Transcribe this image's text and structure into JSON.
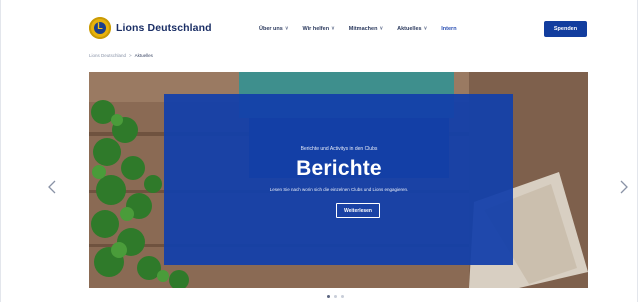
{
  "header": {
    "logo_glyph": "L",
    "logo_text": "Lions Deutschland",
    "nav": [
      {
        "label": "Über uns",
        "has_dropdown": true
      },
      {
        "label": "Wir helfen",
        "has_dropdown": true
      },
      {
        "label": "Mitmachen",
        "has_dropdown": true
      },
      {
        "label": "Aktuelles",
        "has_dropdown": true
      },
      {
        "label": "Intern",
        "has_dropdown": false
      }
    ],
    "donate_label": "Spenden",
    "accent_color": "#123d9e"
  },
  "breadcrumb": {
    "home": "Lions Deutschland",
    "separator": ">",
    "current": "Aktuelles"
  },
  "hero": {
    "kicker": "Berichte und Activitys in den Clubs",
    "title": "Berichte",
    "description": "Lesen Sie nach worin sich die einzelnen Clubs und Lions engagieren.",
    "button_label": "Weiterlesen",
    "overlay_color": "#1340aa"
  },
  "carousel": {
    "prev_icon": "chevron-left-icon",
    "next_icon": "chevron-right-icon",
    "slide_count": 3,
    "active_index": 0
  }
}
